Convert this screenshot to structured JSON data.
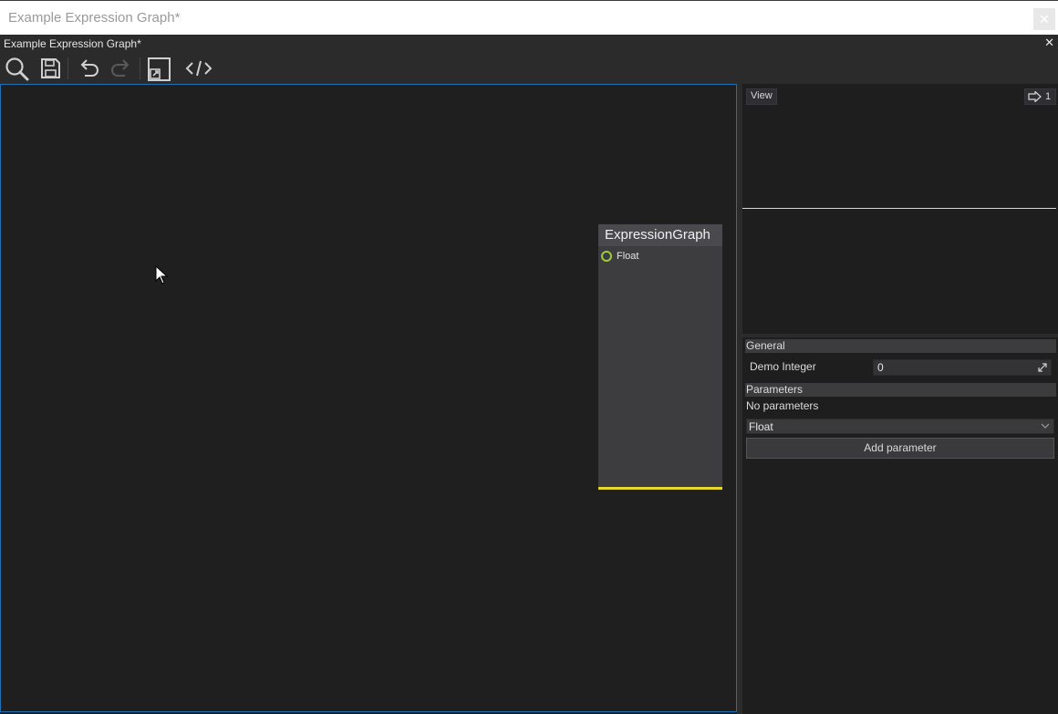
{
  "window": {
    "title": "Example Expression Graph*",
    "close_glyph": "✕"
  },
  "tab": {
    "title": "Example Expression Graph*",
    "close_glyph": "✕"
  },
  "toolbar": {
    "buttons": [
      {
        "name": "search-icon"
      },
      {
        "name": "save-icon"
      },
      {
        "name": "undo-icon"
      },
      {
        "name": "redo-icon"
      },
      {
        "name": "fit-view-icon"
      },
      {
        "name": "code-icon"
      }
    ]
  },
  "node": {
    "title": "ExpressionGraph",
    "pins": [
      {
        "label": "Float",
        "color": "#9ccc3c"
      }
    ],
    "accent_color": "#e6d92b"
  },
  "preview": {
    "view_label": "View",
    "counter": "1"
  },
  "properties": {
    "general": {
      "header": "General",
      "demo_integer_label": "Demo Integer",
      "demo_integer_value": "0"
    },
    "parameters": {
      "header": "Parameters",
      "empty_text": "No parameters",
      "type_selected": "Float",
      "add_button": "Add parameter"
    }
  },
  "colors": {
    "canvas_border": "#1f6fb3",
    "panel_bg": "#2b2b2b",
    "canvas_bg": "#1f1f1f"
  }
}
